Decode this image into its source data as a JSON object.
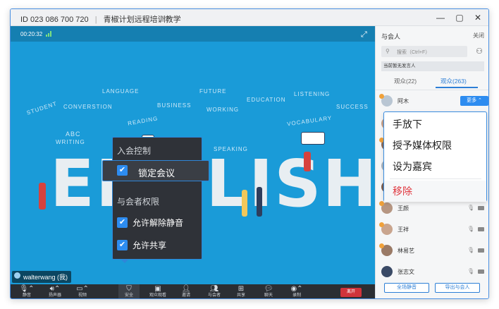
{
  "titlebar": {
    "meeting_id": "ID 023 086 700 720",
    "meeting_name": "青椒计划远程培训教学"
  },
  "video": {
    "timer": "00:20:32",
    "words": [
      "STUDENT",
      "CONVERSTION",
      "LANGUAGE",
      "READING",
      "BUSINESS",
      "FUTURE",
      "WORKING",
      "EDUCATION",
      "LISTENING",
      "VOCABULARY",
      "SUCCESS",
      "ABC",
      "WRITING",
      "SPEAKING",
      "ENGLISH"
    ],
    "user_tag": "walterwang (我)"
  },
  "toolbar": {
    "items": [
      {
        "icon": "mic-icon",
        "label": "静音"
      },
      {
        "icon": "speaker-icon",
        "label": "扬声器"
      },
      {
        "icon": "video-icon",
        "label": "视频"
      },
      {
        "icon": "shield-icon",
        "label": "安全"
      },
      {
        "icon": "live-icon",
        "label": "观众观看"
      },
      {
        "icon": "invite-icon",
        "label": "邀请"
      },
      {
        "icon": "participants-icon",
        "label": "与会者"
      },
      {
        "icon": "share-icon",
        "label": "共享"
      },
      {
        "icon": "chat-icon",
        "label": "聊天"
      },
      {
        "icon": "record-icon",
        "label": "录制"
      }
    ],
    "end_label": "离开"
  },
  "security_menu": {
    "section_join": "入会控制",
    "lock_meeting": "锁定会议",
    "section_perm": "与会者权限",
    "allow_unmute": "允许解除静音",
    "allow_share": "允许共享"
  },
  "panel": {
    "title": "与会人",
    "close": "关闭",
    "search_placeholder": "搜索（Ctrl+F）",
    "note": "当前暂无发言人",
    "tab_audience_1": "观众(22)",
    "tab_audience_2": "观众(263)",
    "more_label": "更多",
    "participants": [
      "阿木",
      "",
      "",
      "",
      "",
      "王颜",
      "王祥",
      "林易艺",
      "张志文"
    ],
    "btn_mute_all": "全场静音",
    "btn_export": "导出与会人"
  },
  "context_menu": {
    "items": [
      "手放下",
      "授予媒体权限",
      "设为嘉宾",
      "移除"
    ]
  },
  "colors": {
    "accent": "#2d8cf0",
    "video_bg": "#1a9bd8",
    "danger": "#e0373f"
  }
}
